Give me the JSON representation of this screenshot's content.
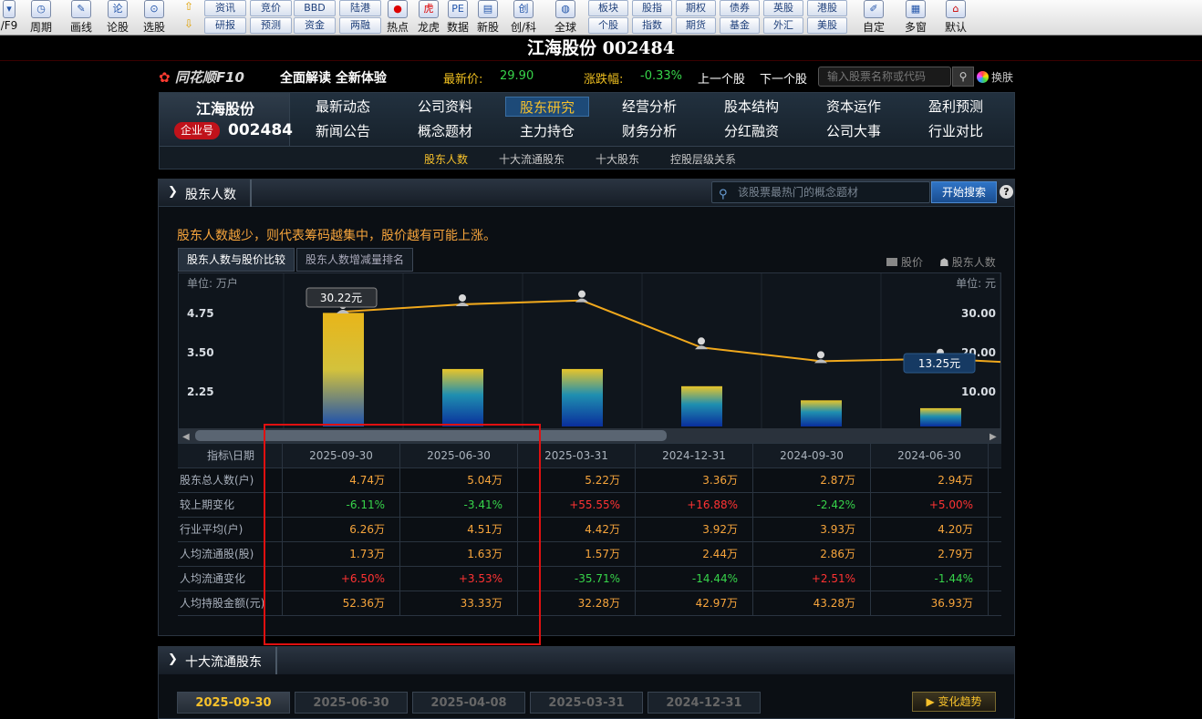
{
  "toolbar": {
    "big_buttons": [
      {
        "label": "/F9",
        "icon": "f9-icon"
      },
      {
        "label": "周期",
        "icon": "clock-icon"
      },
      {
        "label": "画线",
        "icon": "pen-icon"
      },
      {
        "label": "论股",
        "icon": "lun-icon"
      },
      {
        "label": "选股",
        "icon": "select-stock-icon"
      }
    ],
    "grid1": [
      "资讯",
      "竞价",
      "研报",
      "预测"
    ],
    "grid2": [
      "BBD",
      "陆港",
      "资金",
      "两融"
    ],
    "mid_buttons": [
      {
        "label": "热点",
        "icon": "hot-icon"
      },
      {
        "label": "龙虎",
        "icon": "tiger-icon"
      },
      {
        "label": "数据",
        "icon": "pe-data-icon",
        "ic": "PE"
      },
      {
        "label": "新股",
        "icon": "new-stock-icon"
      },
      {
        "label": "创/科",
        "icon": "chuang-icon",
        "ic": "创"
      },
      {
        "label": "全球",
        "icon": "globe-icon"
      }
    ],
    "grid3": [
      "板块",
      "股指",
      "期权",
      "债券",
      "英股",
      "港股",
      "个股",
      "指数",
      "期货",
      "基金",
      "外汇",
      "美股"
    ],
    "right_buttons": [
      {
        "label": "自定",
        "icon": "custom-icon"
      },
      {
        "label": "多窗",
        "icon": "multi-window-icon"
      },
      {
        "label": "默认",
        "icon": "home-icon"
      }
    ]
  },
  "window_title": "江海股份 002484",
  "f10": {
    "logo": "同花顺F10",
    "slogan": "全面解读 全新体验",
    "price_label": "最新价:",
    "price_value": "29.90",
    "change_label": "涨跌幅:",
    "change_value": "-0.33%",
    "prev_stock": "上一个股",
    "next_stock": "下一个股",
    "search_placeholder": "输入股票名称或代码",
    "skin_label": "换肤"
  },
  "nav": {
    "stock_name": "江海股份",
    "badge": "企业号",
    "stock_code": "002484",
    "row1": [
      "最新动态",
      "公司资料",
      "股东研究",
      "经营分析",
      "股本结构",
      "资本运作",
      "盈利预测"
    ],
    "row2": [
      "新闻公告",
      "概念题材",
      "主力持仓",
      "财务分析",
      "分红融资",
      "公司大事",
      "行业对比"
    ],
    "active": "股东研究",
    "sub": [
      "股东人数",
      "十大流通股东",
      "十大股东",
      "控股层级关系"
    ],
    "sub_active": "股东人数"
  },
  "panel": {
    "title": "股东人数",
    "concept_search_placeholder": "该股票最热门的概念题材",
    "concept_search_button": "开始搜索",
    "help": "?",
    "hint": "股东人数越少，则代表筹码越集中，股价越有可能上涨。",
    "tabs": [
      "股东人数与股价比较",
      "股东人数增减量排名"
    ],
    "legend_price": "股价",
    "legend_holders": "股东人数"
  },
  "chart_data": {
    "type": "bar",
    "categories": [
      "2025-09-30",
      "2025-06-30",
      "2025-03-31",
      "2024-12-31",
      "2024-09-30",
      "2024-06-30"
    ],
    "series": [
      {
        "name": "股东人数",
        "values": [
          4.74,
          2.95,
          2.95,
          2.4,
          1.95,
          1.7
        ]
      },
      {
        "name": "股价",
        "values": [
          30.22,
          32.1,
          33.1,
          21.1,
          17.6,
          18.2
        ]
      }
    ],
    "left_unit": "单位: 万户",
    "right_unit": "单位: 元",
    "left_ticks": [
      "4.75",
      "3.50",
      "2.25"
    ],
    "right_ticks": [
      "30.00",
      "20.00",
      "10.00"
    ],
    "tooltips": [
      "30.22元",
      "13.25元"
    ]
  },
  "table": {
    "header_label": "指标\\日期",
    "dates": [
      "2025-09-30",
      "2025-06-30",
      "2025-03-31",
      "2024-12-31",
      "2024-09-30",
      "2024-06-30"
    ],
    "rows": [
      {
        "label": "股东总人数(户)",
        "cells": [
          "4.74万",
          "5.04万",
          "5.22万",
          "3.36万",
          "2.87万",
          "2.94万"
        ],
        "colors": [
          "#f7a53c",
          "#f7a53c",
          "#f7a53c",
          "#f7a53c",
          "#f7a53c",
          "#f7a53c"
        ]
      },
      {
        "label": "较上期变化",
        "cells": [
          "-6.11%",
          "-3.41%",
          "+55.55%",
          "+16.88%",
          "-2.42%",
          "+5.00%"
        ],
        "colors": [
          "#37d44a",
          "#37d44a",
          "#ff3333",
          "#ff3333",
          "#37d44a",
          "#ff3333"
        ]
      },
      {
        "label": "行业平均(户)",
        "cells": [
          "6.26万",
          "4.51万",
          "4.42万",
          "3.92万",
          "3.93万",
          "4.20万"
        ],
        "colors": [
          "#f7a53c",
          "#f7a53c",
          "#f7a53c",
          "#f7a53c",
          "#f7a53c",
          "#f7a53c"
        ]
      },
      {
        "label": "人均流通股(股)",
        "cells": [
          "1.73万",
          "1.63万",
          "1.57万",
          "2.44万",
          "2.86万",
          "2.79万"
        ],
        "colors": [
          "#f7a53c",
          "#f7a53c",
          "#f7a53c",
          "#f7a53c",
          "#f7a53c",
          "#f7a53c"
        ]
      },
      {
        "label": "人均流通变化",
        "cells": [
          "+6.50%",
          "+3.53%",
          "-35.71%",
          "-14.44%",
          "+2.51%",
          "-1.44%"
        ],
        "colors": [
          "#ff3333",
          "#ff3333",
          "#37d44a",
          "#37d44a",
          "#ff3333",
          "#37d44a"
        ]
      },
      {
        "label": "人均持股金额(元)",
        "cells": [
          "52.36万",
          "33.33万",
          "32.28万",
          "42.97万",
          "43.28万",
          "36.93万"
        ],
        "colors": [
          "#f7a53c",
          "#f7a53c",
          "#f7a53c",
          "#f7a53c",
          "#f7a53c",
          "#f7a53c"
        ]
      }
    ]
  },
  "panel2": {
    "title": "十大流通股东",
    "date_tabs": [
      "2025-09-30",
      "2025-06-30",
      "2025-04-08",
      "2025-03-31",
      "2024-12-31"
    ],
    "trend_button": "变化趋势"
  }
}
